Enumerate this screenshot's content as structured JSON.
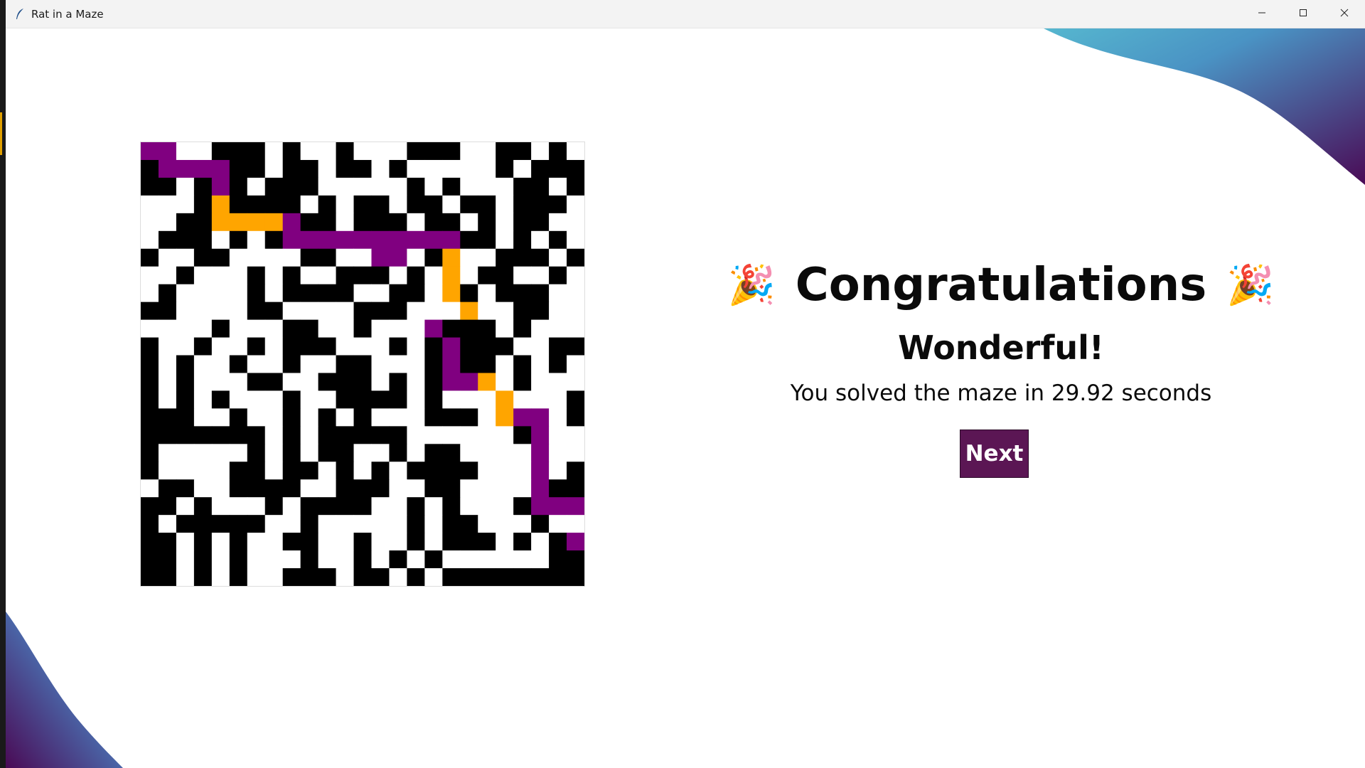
{
  "window": {
    "title": "Rat in a Maze",
    "icons": {
      "app": "feather-icon",
      "minimize": "minimize-icon",
      "maximize": "maximize-icon",
      "close": "close-icon"
    }
  },
  "colors": {
    "wall": "#000000",
    "open": "#ffffff",
    "path_purple": "#800080",
    "path_orange": "#ffa500",
    "goal": "#0b1b2e",
    "button": "#5b1654",
    "deco_dark": "#4a0a55",
    "deco_light": "#56b7cf"
  },
  "maze": {
    "rows": 25,
    "cols": 25,
    "legend": {
      "#": "wall",
      ".": "open",
      "P": "path_purple",
      "O": "path_orange",
      "G": "goal"
    },
    "grid": [
      "PP..###.#..#...###..##.#.",
      "#PPPP##.##.##.#.....#.###",
      "##.#P#.###.....#.#...##.#",
      "...#O####.#.##.##.##.###.",
      "..##OOOOP##.###.##.#.##..",
      ".###.#.#PPPPPPPPPP##.#.#.",
      "#..##....##..PP.#O..###.#",
      "..#...#.#..###.#.O.##..#.",
      ".#....#.####..##.O#.###..",
      "##....##....###...O..##..",
      "....#...##..#...P###.#...",
      "#..#..#.###...#.#P###..##",
      "#.#..#..#..##...#P##.#.#.",
      "#.#...##..###.#.#PPO.#...",
      "#.#.#...#..####.#...O...#",
      "###..#..#.#.#...###.OPP.#",
      "#######.#.#####......#P...",
      "#.....#.#.##..#.##....P...",
      "#....##.##.#.#.####...P.#.",
      ".##..####..###..##....P##.",
      "##.#...#.####..#.#...#PPP#",
      "#.#####..#.....#.##...#..P",
      "##.#.#..##..#..#.###.#.#PP",
      "##.#.#...#..#.#.#......###",
      "##.#.#..###.##.#.#########G"
    ]
  },
  "result": {
    "emoji": "🎉",
    "title": "Congratulations",
    "subtitle": "Wonderful!",
    "message": "You solved the maze in 29.92 seconds",
    "next_label": "Next"
  }
}
